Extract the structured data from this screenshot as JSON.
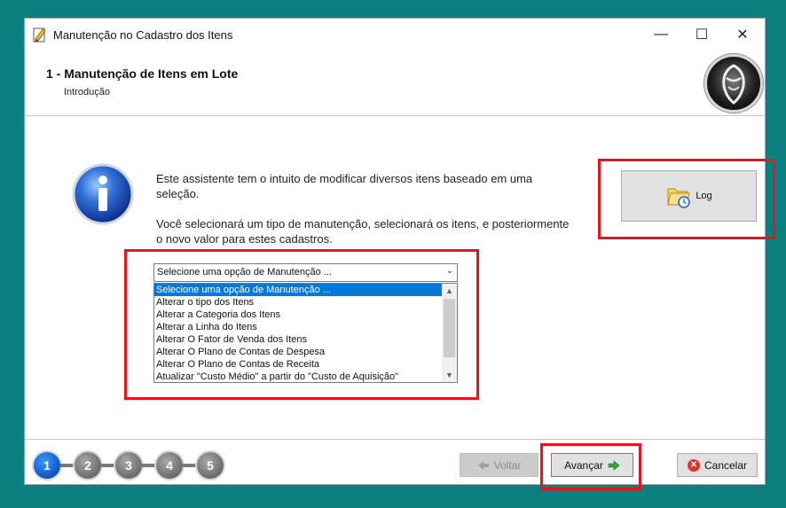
{
  "window": {
    "title": "Manutenção no Cadastro dos Itens",
    "minimize": "—",
    "maximize": "☐",
    "close": "✕"
  },
  "header": {
    "title": "1 - Manutenção de Itens em Lote",
    "subtitle": "Introdução"
  },
  "intro": {
    "paragraph1": "Este assistente tem o intuito de modificar diversos itens baseado em uma seleção.",
    "paragraph2": "Você selecionará um tipo de manutenção, selecionará os itens, e posteriormente o novo valor para estes cadastros."
  },
  "log_button": {
    "label": "Log",
    "icon": "folder-clock-icon"
  },
  "maintenance_select": {
    "value": "Selecione uma opção de Manutenção ...",
    "options": [
      "Selecione uma opção de Manutenção ...",
      "Alterar o tipo dos Itens",
      "Alterar a Categoria dos Itens",
      "Alterar a Linha do Itens",
      "Alterar O Fator de Venda dos Itens",
      "Alterar O Plano de Contas de Despesa",
      "Alterar O Plano de Contas de Receita",
      "Atualizar \"Custo Médio\" a partir do \"Custo de Aquisição\""
    ],
    "selected_index": 0,
    "dropdown_open": true
  },
  "wizard_steps": [
    {
      "label": "1",
      "active": true
    },
    {
      "label": "2",
      "active": false
    },
    {
      "label": "3",
      "active": false
    },
    {
      "label": "4",
      "active": false
    },
    {
      "label": "5",
      "active": false
    }
  ],
  "buttons": {
    "back": "Voltar",
    "next": "Avançar",
    "cancel": "Cancelar"
  },
  "colors": {
    "desktop": "#0b7e7e",
    "highlight": "#e8141b",
    "selection": "#0078d7",
    "step_active": "#0a55c2",
    "step_inactive": "#6b6b6b"
  }
}
